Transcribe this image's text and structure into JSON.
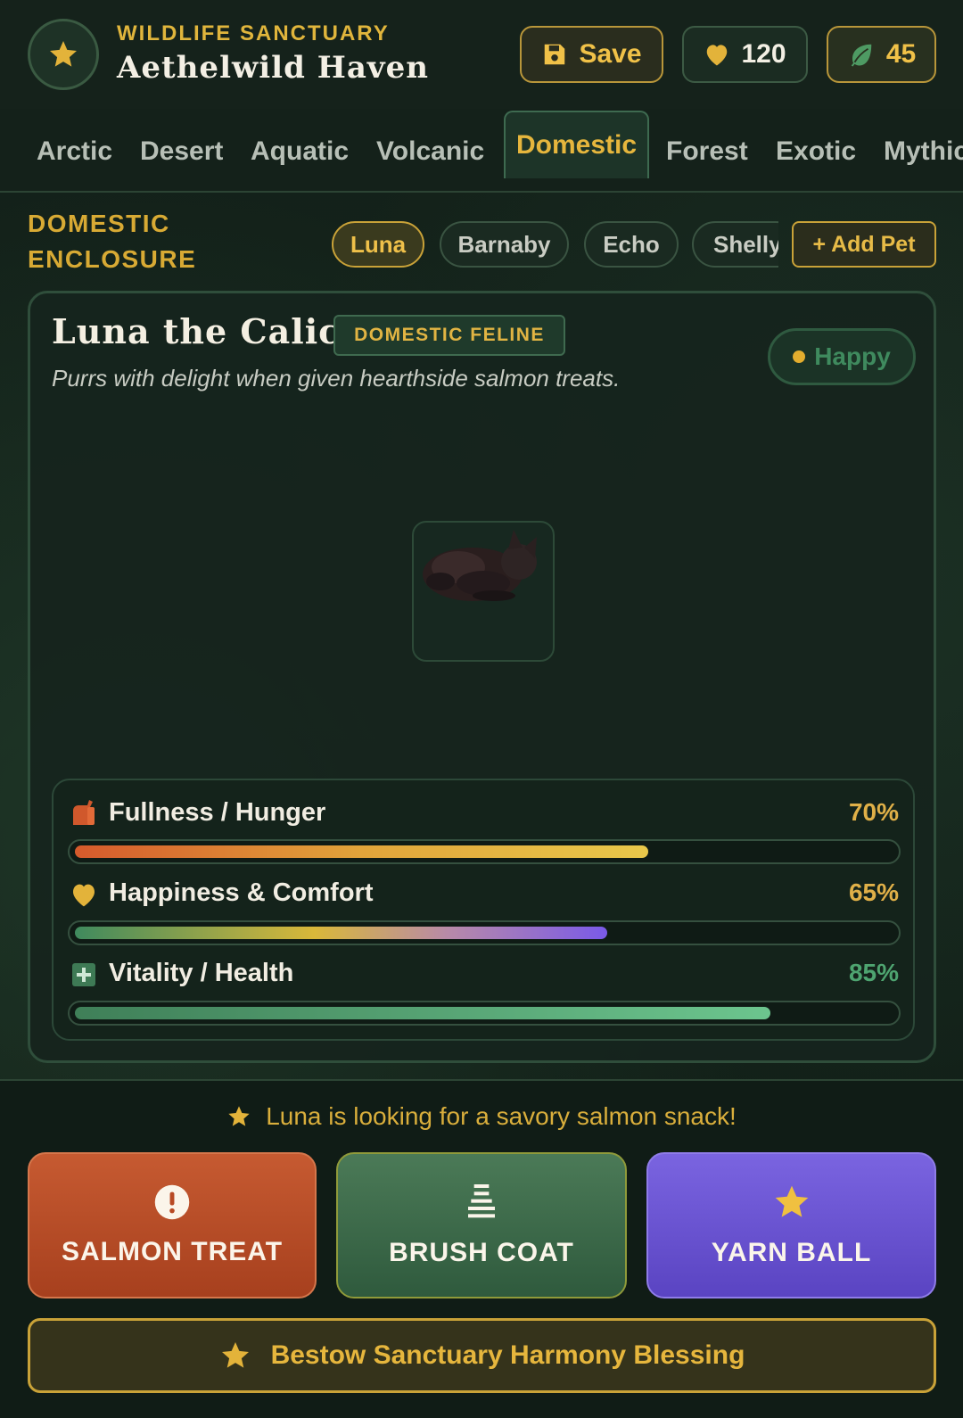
{
  "header": {
    "subtitle": "WILDLIFE SANCTUARY",
    "title": "Aethelwild Haven",
    "save_label": "Save",
    "hearts": "120",
    "leaves": "45"
  },
  "tabs": [
    {
      "label": "Arctic"
    },
    {
      "label": "Desert"
    },
    {
      "label": "Aquatic"
    },
    {
      "label": "Volcanic"
    },
    {
      "label": "Domestic",
      "active": true
    },
    {
      "label": "Forest"
    },
    {
      "label": "Exotic"
    },
    {
      "label": "Mythic"
    }
  ],
  "enclosure": {
    "label": "DOMESTIC ENCLOSURE",
    "pets": [
      {
        "name": "Luna",
        "active": true
      },
      {
        "name": "Barnaby"
      },
      {
        "name": "Echo"
      },
      {
        "name": "Shelly"
      }
    ],
    "add_label": "+ Add Pet"
  },
  "pet": {
    "name": "Luna the Calico",
    "species": "DOMESTIC FELINE",
    "mood": "Happy",
    "description": "Purrs with delight when given hearthside salmon treats.",
    "stats": [
      {
        "label": "Fullness / Hunger",
        "value": "70%",
        "fraction": 0.7,
        "icon": "food-bag-icon"
      },
      {
        "label": "Happiness & Comfort",
        "value": "65%",
        "fraction": 0.65,
        "icon": "heart-icon"
      },
      {
        "label": "Vitality / Health",
        "value": "85%",
        "fraction": 0.85,
        "icon": "health-cross-icon"
      }
    ]
  },
  "hint": "Luna is looking for a savory salmon snack!",
  "actions": {
    "treat": "SALMON TREAT",
    "brush": "BRUSH COAT",
    "yarn": "YARN BALL"
  },
  "blessing": "Bestow Sanctuary Harmony Blessing",
  "colors": {
    "accent_gold": "#e0b53c",
    "treat": "#c65a31",
    "brush": "#3f6e4b",
    "yarn": "#6a54d2"
  }
}
